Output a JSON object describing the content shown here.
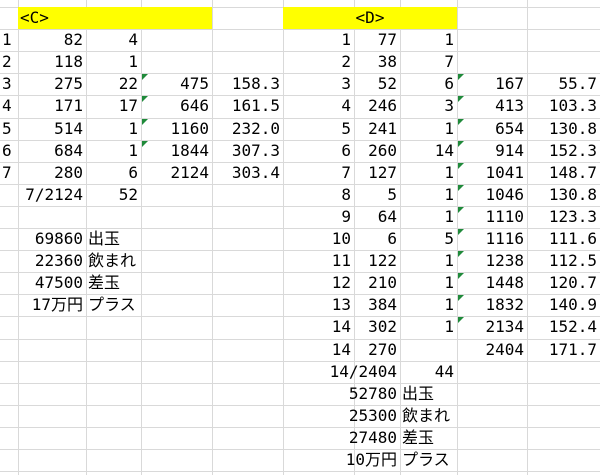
{
  "colors": {
    "header_bg": "#ffff00",
    "gridline": "#d9d9d9",
    "error_marker": "#1f8a3a"
  },
  "sheet": {
    "C": {
      "header": "<C>",
      "rows": [
        {
          "idx": "1",
          "a": "82",
          "b": "4",
          "c": "",
          "d": "",
          "tri": false
        },
        {
          "idx": "2",
          "a": "118",
          "b": "1",
          "c": "",
          "d": "",
          "tri": false
        },
        {
          "idx": "3",
          "a": "275",
          "b": "22",
          "c": "475",
          "d": "158.3",
          "tri": true
        },
        {
          "idx": "4",
          "a": "171",
          "b": "17",
          "c": "646",
          "d": "161.5",
          "tri": true
        },
        {
          "idx": "5",
          "a": "514",
          "b": "1",
          "c": "1160",
          "d": "232.0",
          "tri": true
        },
        {
          "idx": "6",
          "a": "684",
          "b": "1",
          "c": "1844",
          "d": "307.3",
          "tri": true
        },
        {
          "idx": "7",
          "a": "280",
          "b": "6",
          "c": "2124",
          "d": "303.4",
          "tri": false
        },
        {
          "idx": "",
          "a": "7/2124",
          "b": "52",
          "c": "",
          "d": "",
          "tri": false
        }
      ],
      "summary": [
        {
          "value": "69860",
          "label": "出玉"
        },
        {
          "value": "22360",
          "label": "飲まれ"
        },
        {
          "value": "47500",
          "label": "差玉"
        },
        {
          "value": "17万円",
          "label": "プラス"
        }
      ]
    },
    "D": {
      "header": "<D>",
      "rows": [
        {
          "idx": "1",
          "a": "77",
          "b": "1",
          "c": "",
          "d": "",
          "tri": false
        },
        {
          "idx": "2",
          "a": "38",
          "b": "7",
          "c": "",
          "d": "",
          "tri": false
        },
        {
          "idx": "3",
          "a": "52",
          "b": "6",
          "c": "167",
          "d": "55.7",
          "tri": true
        },
        {
          "idx": "4",
          "a": "246",
          "b": "3",
          "c": "413",
          "d": "103.3",
          "tri": true
        },
        {
          "idx": "5",
          "a": "241",
          "b": "1",
          "c": "654",
          "d": "130.8",
          "tri": true
        },
        {
          "idx": "6",
          "a": "260",
          "b": "14",
          "c": "914",
          "d": "152.3",
          "tri": true
        },
        {
          "idx": "7",
          "a": "127",
          "b": "1",
          "c": "1041",
          "d": "148.7",
          "tri": true
        },
        {
          "idx": "8",
          "a": "5",
          "b": "1",
          "c": "1046",
          "d": "130.8",
          "tri": true
        },
        {
          "idx": "9",
          "a": "64",
          "b": "1",
          "c": "1110",
          "d": "123.3",
          "tri": true
        },
        {
          "idx": "10",
          "a": "6",
          "b": "5",
          "c": "1116",
          "d": "111.6",
          "tri": true
        },
        {
          "idx": "11",
          "a": "122",
          "b": "1",
          "c": "1238",
          "d": "112.5",
          "tri": true
        },
        {
          "idx": "12",
          "a": "210",
          "b": "1",
          "c": "1448",
          "d": "120.7",
          "tri": true
        },
        {
          "idx": "13",
          "a": "384",
          "b": "1",
          "c": "1832",
          "d": "140.9",
          "tri": true
        },
        {
          "idx": "14",
          "a": "302",
          "b": "1",
          "c": "2134",
          "d": "152.4",
          "tri": true
        },
        {
          "idx": "14",
          "a": "270",
          "b": "",
          "c": "2404",
          "d": "171.7",
          "tri": false
        }
      ],
      "total": {
        "a": "14/2404",
        "b": "44"
      },
      "summary": [
        {
          "value": "52780",
          "label": "出玉"
        },
        {
          "value": "25300",
          "label": "飲まれ"
        },
        {
          "value": "27480",
          "label": "差玉"
        },
        {
          "value": "10万円",
          "label": "プラス"
        }
      ]
    }
  }
}
